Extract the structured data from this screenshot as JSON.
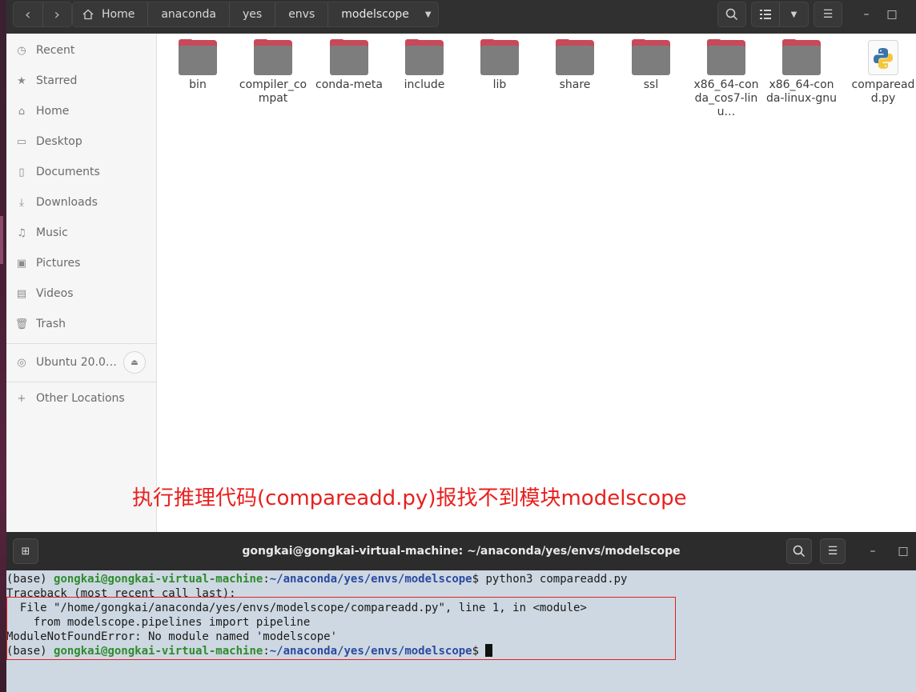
{
  "file_manager": {
    "path": [
      "Home",
      "anaconda",
      "yes",
      "envs",
      "modelscope"
    ],
    "sidebar": {
      "items": [
        "Recent",
        "Starred",
        "Home",
        "Desktop",
        "Documents",
        "Downloads",
        "Music",
        "Pictures",
        "Videos",
        "Trash"
      ],
      "device": "Ubuntu 20.0…",
      "other_locations": "Other Locations"
    },
    "files": [
      {
        "name": "bin",
        "type": "folder"
      },
      {
        "name": "compiler_compat",
        "type": "folder"
      },
      {
        "name": "conda-meta",
        "type": "folder"
      },
      {
        "name": "include",
        "type": "folder"
      },
      {
        "name": "lib",
        "type": "folder"
      },
      {
        "name": "share",
        "type": "folder"
      },
      {
        "name": "ssl",
        "type": "folder"
      },
      {
        "name": "x86_64-conda_cos7-linu…",
        "type": "folder"
      },
      {
        "name": "x86_64-conda-linux-gnu",
        "type": "folder"
      },
      {
        "name": "compareadd.py",
        "type": "python"
      }
    ]
  },
  "annotation": "执行推理代码(compareadd.py)报找不到模块modelscope",
  "terminal": {
    "title": "gongkai@gongkai-virtual-machine: ~/anaconda/yes/envs/modelscope",
    "env": "(base) ",
    "user_host": "gongkai@gongkai-virtual-machine",
    "colon": ":",
    "cwd": "~/anaconda/yes/envs/modelscope",
    "prompt": "$ ",
    "command": "python3 compareadd.py",
    "lines": [
      "Traceback (most recent call last):",
      "  File \"/home/gongkai/anaconda/yes/envs/modelscope/compareadd.py\", line 1, in <module>",
      "    from modelscope.pipelines import pipeline",
      "ModuleNotFoundError: No module named 'modelscope'"
    ],
    "prompt_end": "$ "
  },
  "colors": {
    "header_bg": "#303030",
    "folder_accent": "#c8495a",
    "annotation": "#e8201e",
    "terminal_bg": "#ced8e2",
    "user_green": "#2e8b2e",
    "path_blue": "#2a4aa0"
  }
}
